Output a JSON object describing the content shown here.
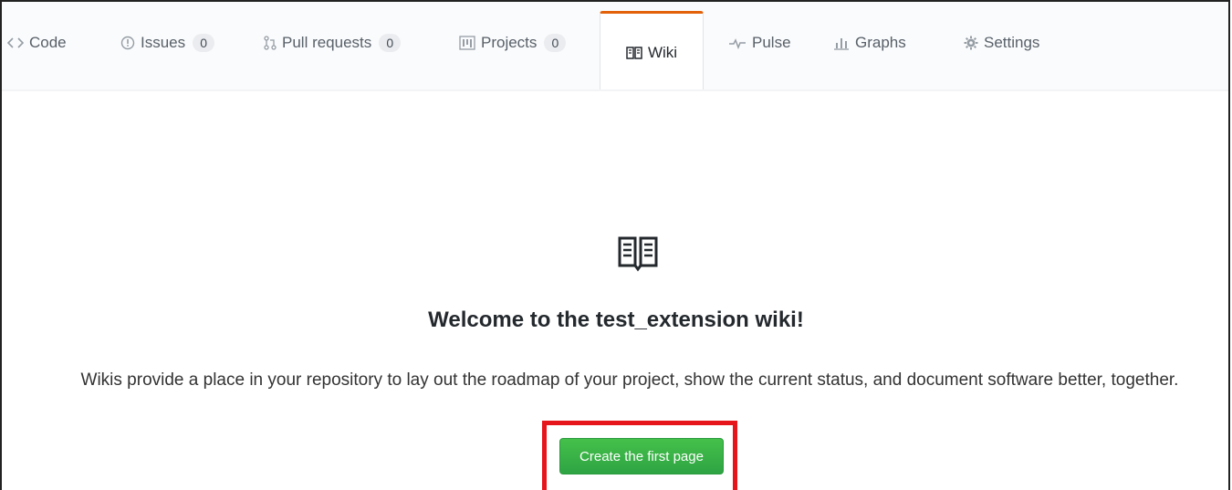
{
  "tabs": [
    {
      "label": "Code",
      "icon": "code-icon"
    },
    {
      "label": "Issues",
      "count": "0",
      "icon": "issue-icon"
    },
    {
      "label": "Pull requests",
      "count": "0",
      "icon": "pull-request-icon"
    },
    {
      "label": "Projects",
      "count": "0",
      "icon": "project-icon"
    },
    {
      "label": "Wiki",
      "icon": "book-icon",
      "active": true
    },
    {
      "label": "Pulse",
      "icon": "pulse-icon"
    },
    {
      "label": "Graphs",
      "icon": "graph-icon"
    },
    {
      "label": "Settings",
      "icon": "gear-icon"
    }
  ],
  "wiki": {
    "title": "Welcome to the test_extension wiki!",
    "description": "Wikis provide a place in your repository to lay out the roadmap of your project, show the current status, and document software better, together.",
    "create_button": "Create the first page"
  },
  "colors": {
    "accent": "#e36209",
    "button": "#2ea443",
    "highlight": "#e5151b"
  }
}
